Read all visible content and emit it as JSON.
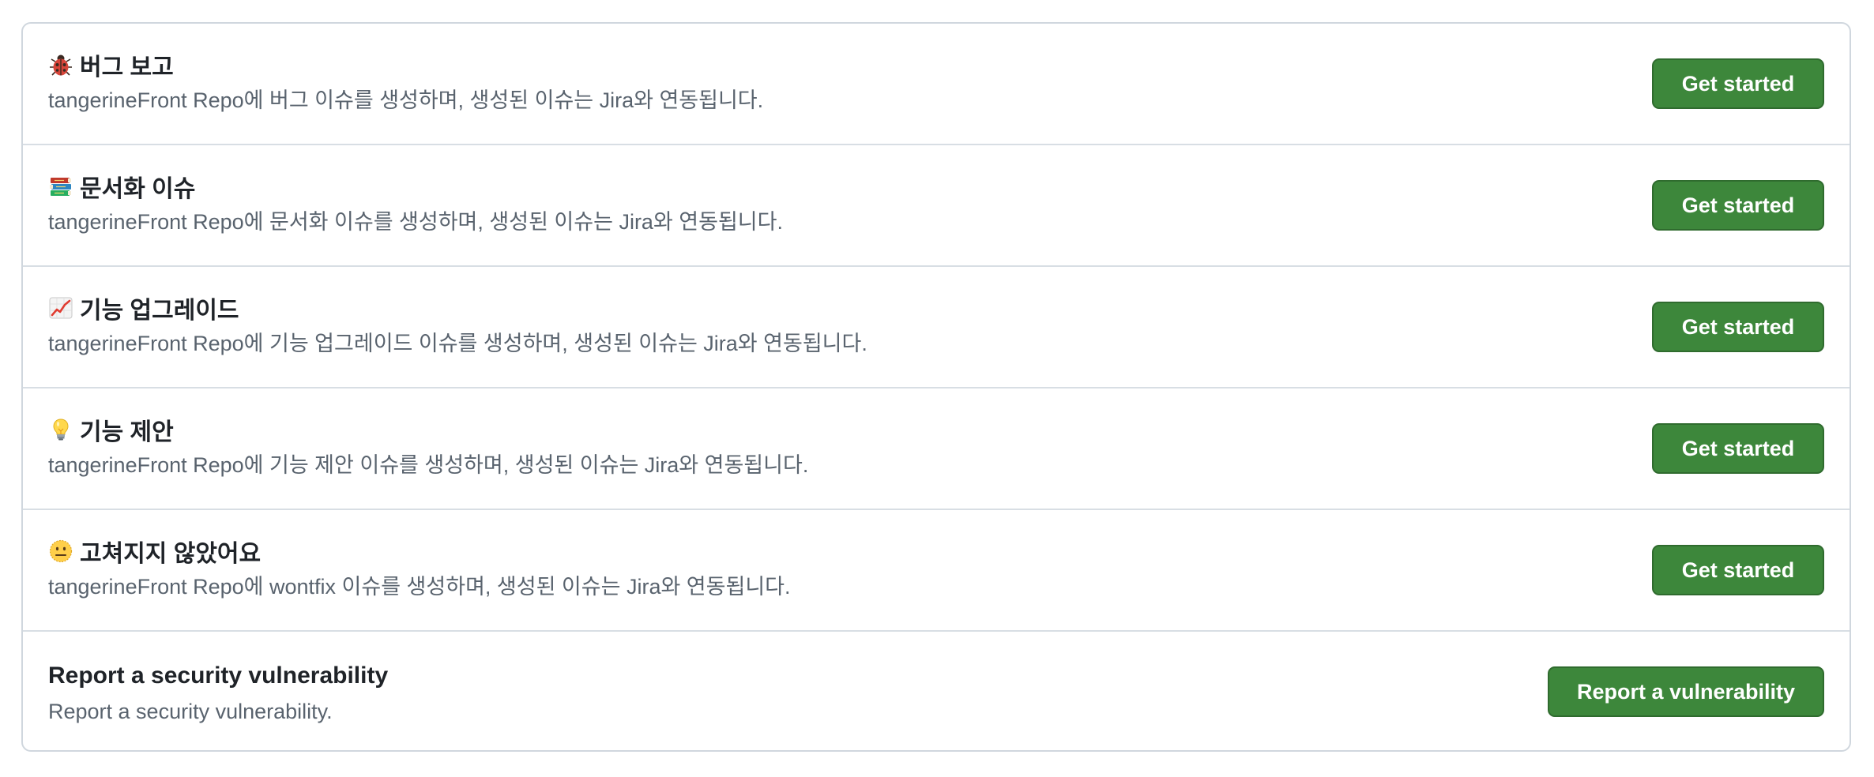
{
  "templates": [
    {
      "icon": "lady-beetle-icon",
      "title": "버그 보고",
      "description": "tangerineFront Repo에 버그 이슈를 생성하며, 생성된 이슈는 Jira와 연동됩니다.",
      "button_label": "Get started"
    },
    {
      "icon": "books-icon",
      "title": "문서화 이슈",
      "description": "tangerineFront Repo에 문서화 이슈를 생성하며, 생성된 이슈는 Jira와 연동됩니다.",
      "button_label": "Get started"
    },
    {
      "icon": "chart-increasing-icon",
      "title": "기능 업그레이드",
      "description": "tangerineFront Repo에 기능 업그레이드 이슈를 생성하며, 생성된 이슈는 Jira와 연동됩니다.",
      "button_label": "Get started"
    },
    {
      "icon": "light-bulb-icon",
      "title": "기능 제안",
      "description": "tangerineFront Repo에 기능 제안 이슈를 생성하며, 생성된 이슈는 Jira와 연동됩니다.",
      "button_label": "Get started"
    },
    {
      "icon": "neutral-face-icon",
      "title": "고쳐지지 않았어요",
      "description": "tangerineFront Repo에 wontfix 이슈를 생성하며, 생성된 이슈는 Jira와 연동됩니다.",
      "button_label": "Get started"
    }
  ],
  "security": {
    "title": "Report a security vulnerability",
    "description": "Report a security vulnerability.",
    "button_label": "Report a vulnerability"
  },
  "colors": {
    "button_bg": "#3d873b",
    "button_border": "#2f6b2e",
    "border": "#d0d7de",
    "text": "#1f2328",
    "muted_text": "#59636e"
  }
}
